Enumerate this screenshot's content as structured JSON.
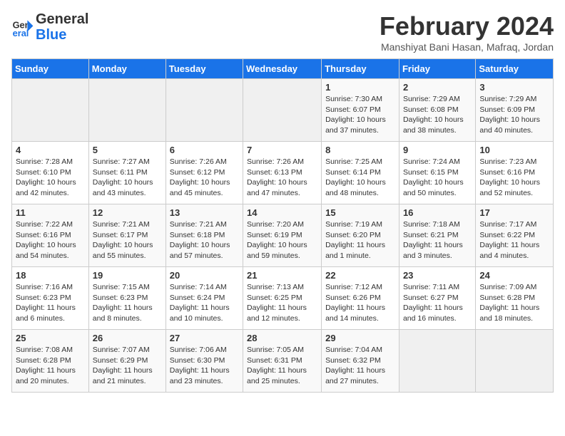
{
  "logo": {
    "text_part1": "General",
    "text_part2": "Blue"
  },
  "title": "February 2024",
  "location": "Manshiyat Bani Hasan, Mafraq, Jordan",
  "days_of_week": [
    "Sunday",
    "Monday",
    "Tuesday",
    "Wednesday",
    "Thursday",
    "Friday",
    "Saturday"
  ],
  "weeks": [
    [
      {
        "day": "",
        "content": ""
      },
      {
        "day": "",
        "content": ""
      },
      {
        "day": "",
        "content": ""
      },
      {
        "day": "",
        "content": ""
      },
      {
        "day": "1",
        "content": "Sunrise: 7:30 AM\nSunset: 6:07 PM\nDaylight: 10 hours\nand 37 minutes."
      },
      {
        "day": "2",
        "content": "Sunrise: 7:29 AM\nSunset: 6:08 PM\nDaylight: 10 hours\nand 38 minutes."
      },
      {
        "day": "3",
        "content": "Sunrise: 7:29 AM\nSunset: 6:09 PM\nDaylight: 10 hours\nand 40 minutes."
      }
    ],
    [
      {
        "day": "4",
        "content": "Sunrise: 7:28 AM\nSunset: 6:10 PM\nDaylight: 10 hours\nand 42 minutes."
      },
      {
        "day": "5",
        "content": "Sunrise: 7:27 AM\nSunset: 6:11 PM\nDaylight: 10 hours\nand 43 minutes."
      },
      {
        "day": "6",
        "content": "Sunrise: 7:26 AM\nSunset: 6:12 PM\nDaylight: 10 hours\nand 45 minutes."
      },
      {
        "day": "7",
        "content": "Sunrise: 7:26 AM\nSunset: 6:13 PM\nDaylight: 10 hours\nand 47 minutes."
      },
      {
        "day": "8",
        "content": "Sunrise: 7:25 AM\nSunset: 6:14 PM\nDaylight: 10 hours\nand 48 minutes."
      },
      {
        "day": "9",
        "content": "Sunrise: 7:24 AM\nSunset: 6:15 PM\nDaylight: 10 hours\nand 50 minutes."
      },
      {
        "day": "10",
        "content": "Sunrise: 7:23 AM\nSunset: 6:16 PM\nDaylight: 10 hours\nand 52 minutes."
      }
    ],
    [
      {
        "day": "11",
        "content": "Sunrise: 7:22 AM\nSunset: 6:16 PM\nDaylight: 10 hours\nand 54 minutes."
      },
      {
        "day": "12",
        "content": "Sunrise: 7:21 AM\nSunset: 6:17 PM\nDaylight: 10 hours\nand 55 minutes."
      },
      {
        "day": "13",
        "content": "Sunrise: 7:21 AM\nSunset: 6:18 PM\nDaylight: 10 hours\nand 57 minutes."
      },
      {
        "day": "14",
        "content": "Sunrise: 7:20 AM\nSunset: 6:19 PM\nDaylight: 10 hours\nand 59 minutes."
      },
      {
        "day": "15",
        "content": "Sunrise: 7:19 AM\nSunset: 6:20 PM\nDaylight: 11 hours\nand 1 minute."
      },
      {
        "day": "16",
        "content": "Sunrise: 7:18 AM\nSunset: 6:21 PM\nDaylight: 11 hours\nand 3 minutes."
      },
      {
        "day": "17",
        "content": "Sunrise: 7:17 AM\nSunset: 6:22 PM\nDaylight: 11 hours\nand 4 minutes."
      }
    ],
    [
      {
        "day": "18",
        "content": "Sunrise: 7:16 AM\nSunset: 6:23 PM\nDaylight: 11 hours\nand 6 minutes."
      },
      {
        "day": "19",
        "content": "Sunrise: 7:15 AM\nSunset: 6:23 PM\nDaylight: 11 hours\nand 8 minutes."
      },
      {
        "day": "20",
        "content": "Sunrise: 7:14 AM\nSunset: 6:24 PM\nDaylight: 11 hours\nand 10 minutes."
      },
      {
        "day": "21",
        "content": "Sunrise: 7:13 AM\nSunset: 6:25 PM\nDaylight: 11 hours\nand 12 minutes."
      },
      {
        "day": "22",
        "content": "Sunrise: 7:12 AM\nSunset: 6:26 PM\nDaylight: 11 hours\nand 14 minutes."
      },
      {
        "day": "23",
        "content": "Sunrise: 7:11 AM\nSunset: 6:27 PM\nDaylight: 11 hours\nand 16 minutes."
      },
      {
        "day": "24",
        "content": "Sunrise: 7:09 AM\nSunset: 6:28 PM\nDaylight: 11 hours\nand 18 minutes."
      }
    ],
    [
      {
        "day": "25",
        "content": "Sunrise: 7:08 AM\nSunset: 6:28 PM\nDaylight: 11 hours\nand 20 minutes."
      },
      {
        "day": "26",
        "content": "Sunrise: 7:07 AM\nSunset: 6:29 PM\nDaylight: 11 hours\nand 21 minutes."
      },
      {
        "day": "27",
        "content": "Sunrise: 7:06 AM\nSunset: 6:30 PM\nDaylight: 11 hours\nand 23 minutes."
      },
      {
        "day": "28",
        "content": "Sunrise: 7:05 AM\nSunset: 6:31 PM\nDaylight: 11 hours\nand 25 minutes."
      },
      {
        "day": "29",
        "content": "Sunrise: 7:04 AM\nSunset: 6:32 PM\nDaylight: 11 hours\nand 27 minutes."
      },
      {
        "day": "",
        "content": ""
      },
      {
        "day": "",
        "content": ""
      }
    ]
  ]
}
